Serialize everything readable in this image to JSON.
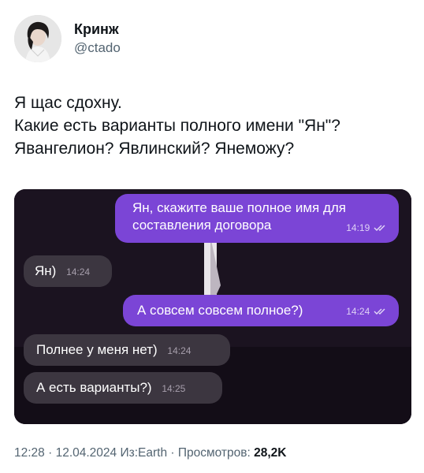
{
  "author": {
    "display_name": "Кринж",
    "handle": "@ctado",
    "avatar_icon": "profile-photo"
  },
  "tweet": {
    "lines": [
      "Я щас сдохну.",
      "Какие есть варианты полного имени \"Ян\"?",
      "Явангелион? Явлинский? Янеможу?"
    ]
  },
  "chat": {
    "messages": [
      {
        "direction": "outgoing",
        "lines": [
          "Ян, скажите ваше полное имя для",
          "составления договора"
        ],
        "time": "14:19",
        "status_icon": "read-double-check-icon"
      },
      {
        "direction": "incoming",
        "lines": [
          "Ян)"
        ],
        "time": "14:24"
      },
      {
        "direction": "outgoing",
        "lines": [
          "А совсем совсем полное?)"
        ],
        "time": "14:24",
        "status_icon": "read-double-check-icon"
      },
      {
        "direction": "incoming",
        "lines": [
          "Полнее у меня нет)"
        ],
        "time": "14:24"
      },
      {
        "direction": "incoming",
        "lines": [
          "А есть варианты?)"
        ],
        "time": "14:25"
      }
    ],
    "colors": {
      "outgoing": "#7b45d6",
      "incoming": "#3c3640",
      "background": "#1b1320"
    }
  },
  "meta": {
    "time": "12:28",
    "sep1": " · ",
    "date": "12.04.2024",
    "source": " Из:Earth",
    "sep2": " · ",
    "views_label": "Просмотров: ",
    "views_count": "28,2K"
  }
}
